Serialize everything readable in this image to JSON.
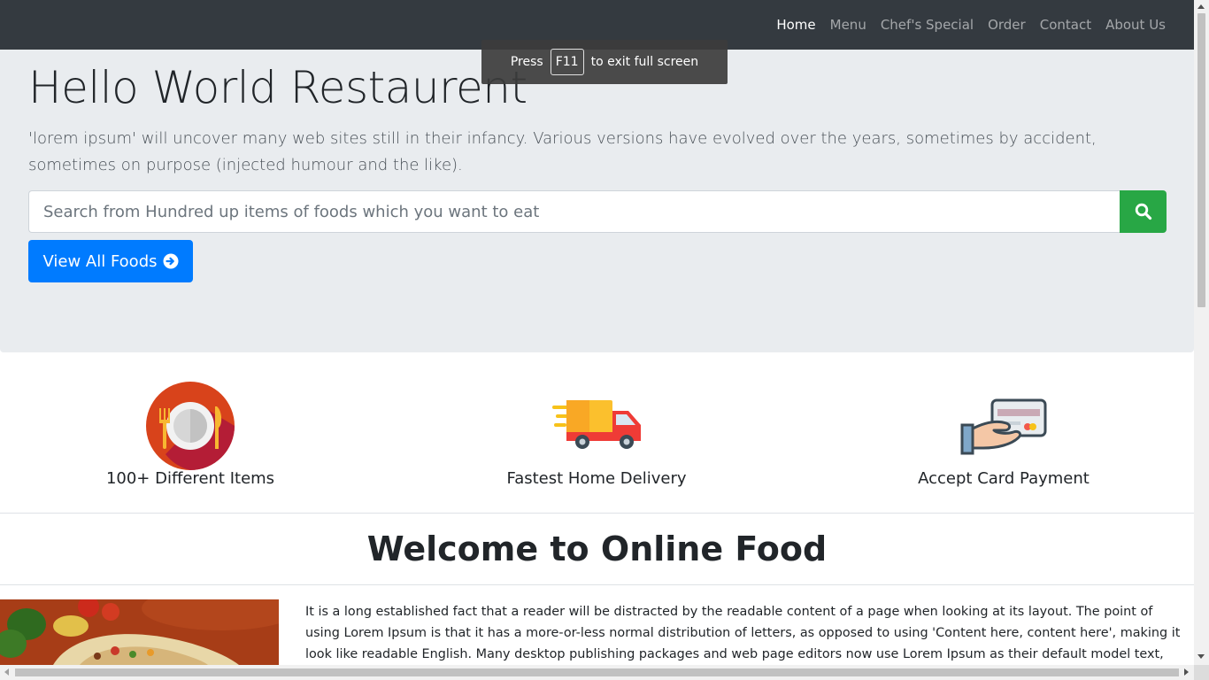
{
  "nav": {
    "items": [
      {
        "label": "Home",
        "active": true
      },
      {
        "label": "Menu"
      },
      {
        "label": "Chef's Special"
      },
      {
        "label": "Order"
      },
      {
        "label": "Contact"
      },
      {
        "label": "About Us"
      }
    ]
  },
  "hero": {
    "title": "Hello World Restaurent",
    "lead": "'lorem ipsum' will uncover many web sites still in their infancy. Various versions have evolved over the years, sometimes by accident, sometimes on purpose (injected humour and the like).",
    "search_placeholder": "Search from Hundred up items of foods which you want to eat",
    "search_icon": "search-icon",
    "view_all_label": "View All Foods",
    "view_all_icon": "arrow-circle-right-icon"
  },
  "features": [
    {
      "label": "100+ Different Items",
      "icon": "plate-cutlery-icon"
    },
    {
      "label": "Fastest Home Delivery",
      "icon": "delivery-truck-icon"
    },
    {
      "label": "Accept Card Payment",
      "icon": "card-payment-icon"
    }
  ],
  "welcome": {
    "title": "Welcome to Online Food",
    "text": "It is a long established fact that a reader will be distracted by the readable content of a page when looking at its layout. The point of using Lorem Ipsum is that it has a more-or-less normal distribution of letters, as opposed to using 'Content here, content here', making it look like readable English. Many desktop publishing packages and web page editors now use Lorem Ipsum as their default model text, and a search for"
  },
  "fullscreen_toast": {
    "prefix": "Press",
    "key": "F11",
    "suffix": "to exit full screen"
  },
  "colors": {
    "navbar": "#343a40",
    "jumbotron": "#e9ecef",
    "search_button": "#28a745",
    "primary_button": "#007bff"
  }
}
